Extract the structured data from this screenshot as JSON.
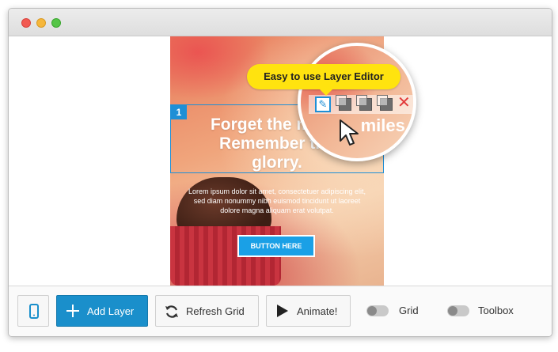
{
  "window": {
    "controls": [
      "close",
      "minimize",
      "maximize"
    ]
  },
  "slide": {
    "layer_number": "1",
    "headline": "Forget the miles. Remember the glorry.",
    "body": "Lorem ipsum dolor sit amet, consectetuer adipiscing elit, sed diam nonummy nibh euismod tincidunt ut laoreet dolore magna aliquam erat volutpat.",
    "button_label": "BUTTON HERE"
  },
  "magnifier": {
    "tooltip": "Easy to use Layer Editor",
    "visible_text": "miles.",
    "tools": [
      "edit-icon",
      "duplicate-icon",
      "copy-icon",
      "paste-icon",
      "close-icon"
    ],
    "close_color": "#e23a3a"
  },
  "toolbar": {
    "add_layer": "Add Layer",
    "refresh_grid": "Refresh Grid",
    "animate": "Animate!",
    "grid": "Grid",
    "toolbox": "Toolbox",
    "accent": "#1a8fcb"
  }
}
